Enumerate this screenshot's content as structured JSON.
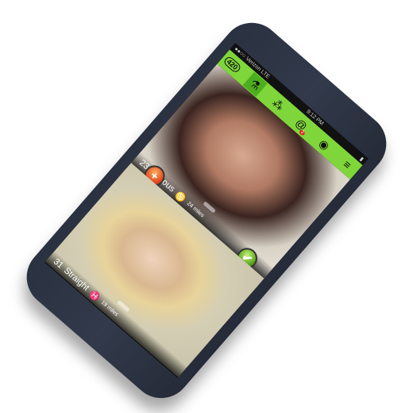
{
  "status_bar": {
    "carrier": "●●○○ Verizon  LTE",
    "time": "9:12 PM",
    "battery": "▮"
  },
  "nav": {
    "logo": "420",
    "items": [
      {
        "icon": "flask-icon",
        "glyph": "⚗"
      },
      {
        "icon": "grapes-icon",
        "glyph": "⁂"
      },
      {
        "icon": "at-icon",
        "glyph": "@",
        "badge": "2"
      },
      {
        "icon": "eye-icon",
        "glyph": "◉"
      },
      {
        "icon": "menu-icon",
        "glyph": "≡"
      }
    ]
  },
  "profiles": [
    {
      "age": "23",
      "orientation": "Curious",
      "zodiac": "♋",
      "distance": "24 miles"
    },
    {
      "age": "31",
      "orientation": "Straight",
      "zodiac": "♓",
      "distance": "19 miles"
    }
  ],
  "buttons": {
    "add": "+",
    "like": "✔",
    "expand": "«"
  }
}
